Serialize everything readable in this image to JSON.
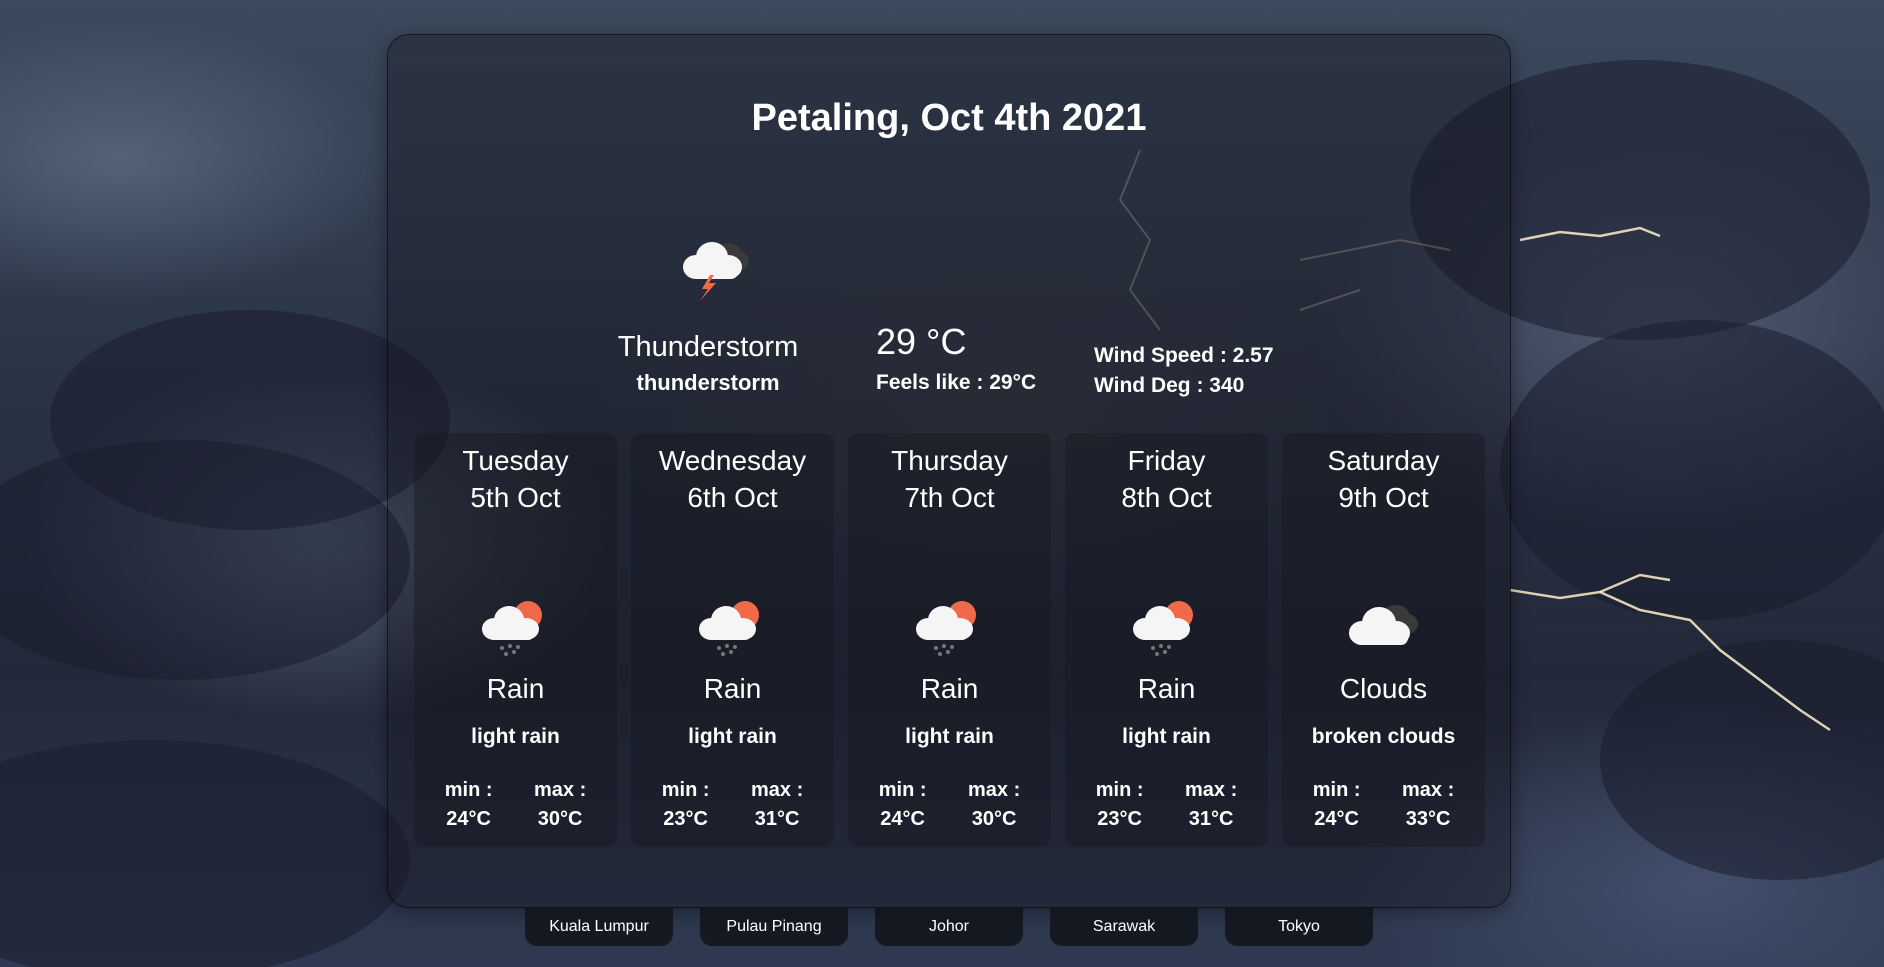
{
  "header": {
    "title": "Petaling, Oct 4th 2021"
  },
  "current": {
    "icon": "thunderstorm-icon",
    "main": "Thunderstorm",
    "description": "thunderstorm",
    "temp": "29 °C",
    "feels_like": "Feels like : 29°C",
    "wind_speed": "Wind Speed : 2.57",
    "wind_deg": "Wind Deg : 340"
  },
  "forecast": [
    {
      "day": "Tuesday",
      "date": "5th Oct",
      "icon": "rain-sun-icon",
      "main": "Rain",
      "description": "light rain",
      "min_label": "min :",
      "min": "24°C",
      "max_label": "max :",
      "max": "30°C"
    },
    {
      "day": "Wednesday",
      "date": "6th Oct",
      "icon": "rain-sun-icon",
      "main": "Rain",
      "description": "light rain",
      "min_label": "min :",
      "min": "23°C",
      "max_label": "max :",
      "max": "31°C"
    },
    {
      "day": "Thursday",
      "date": "7th Oct",
      "icon": "rain-sun-icon",
      "main": "Rain",
      "description": "light rain",
      "min_label": "min :",
      "min": "24°C",
      "max_label": "max :",
      "max": "30°C"
    },
    {
      "day": "Friday",
      "date": "8th Oct",
      "icon": "rain-sun-icon",
      "main": "Rain",
      "description": "light rain",
      "min_label": "min :",
      "min": "23°C",
      "max_label": "max :",
      "max": "31°C"
    },
    {
      "day": "Saturday",
      "date": "9th Oct",
      "icon": "broken-clouds-icon",
      "main": "Clouds",
      "description": "broken clouds",
      "min_label": "min :",
      "min": "24°C",
      "max_label": "max :",
      "max": "33°C"
    }
  ],
  "city_tabs": [
    {
      "label": "Kuala Lumpur"
    },
    {
      "label": "Pulau Pinang"
    },
    {
      "label": "Johor"
    },
    {
      "label": "Sarawak"
    },
    {
      "label": "Tokyo"
    }
  ],
  "colors": {
    "sun": "#ef6a48",
    "cloud_front": "#f5f5f5",
    "cloud_back": "#3a3a3a",
    "bolt": "#ef6a48",
    "rain": "#777777"
  }
}
